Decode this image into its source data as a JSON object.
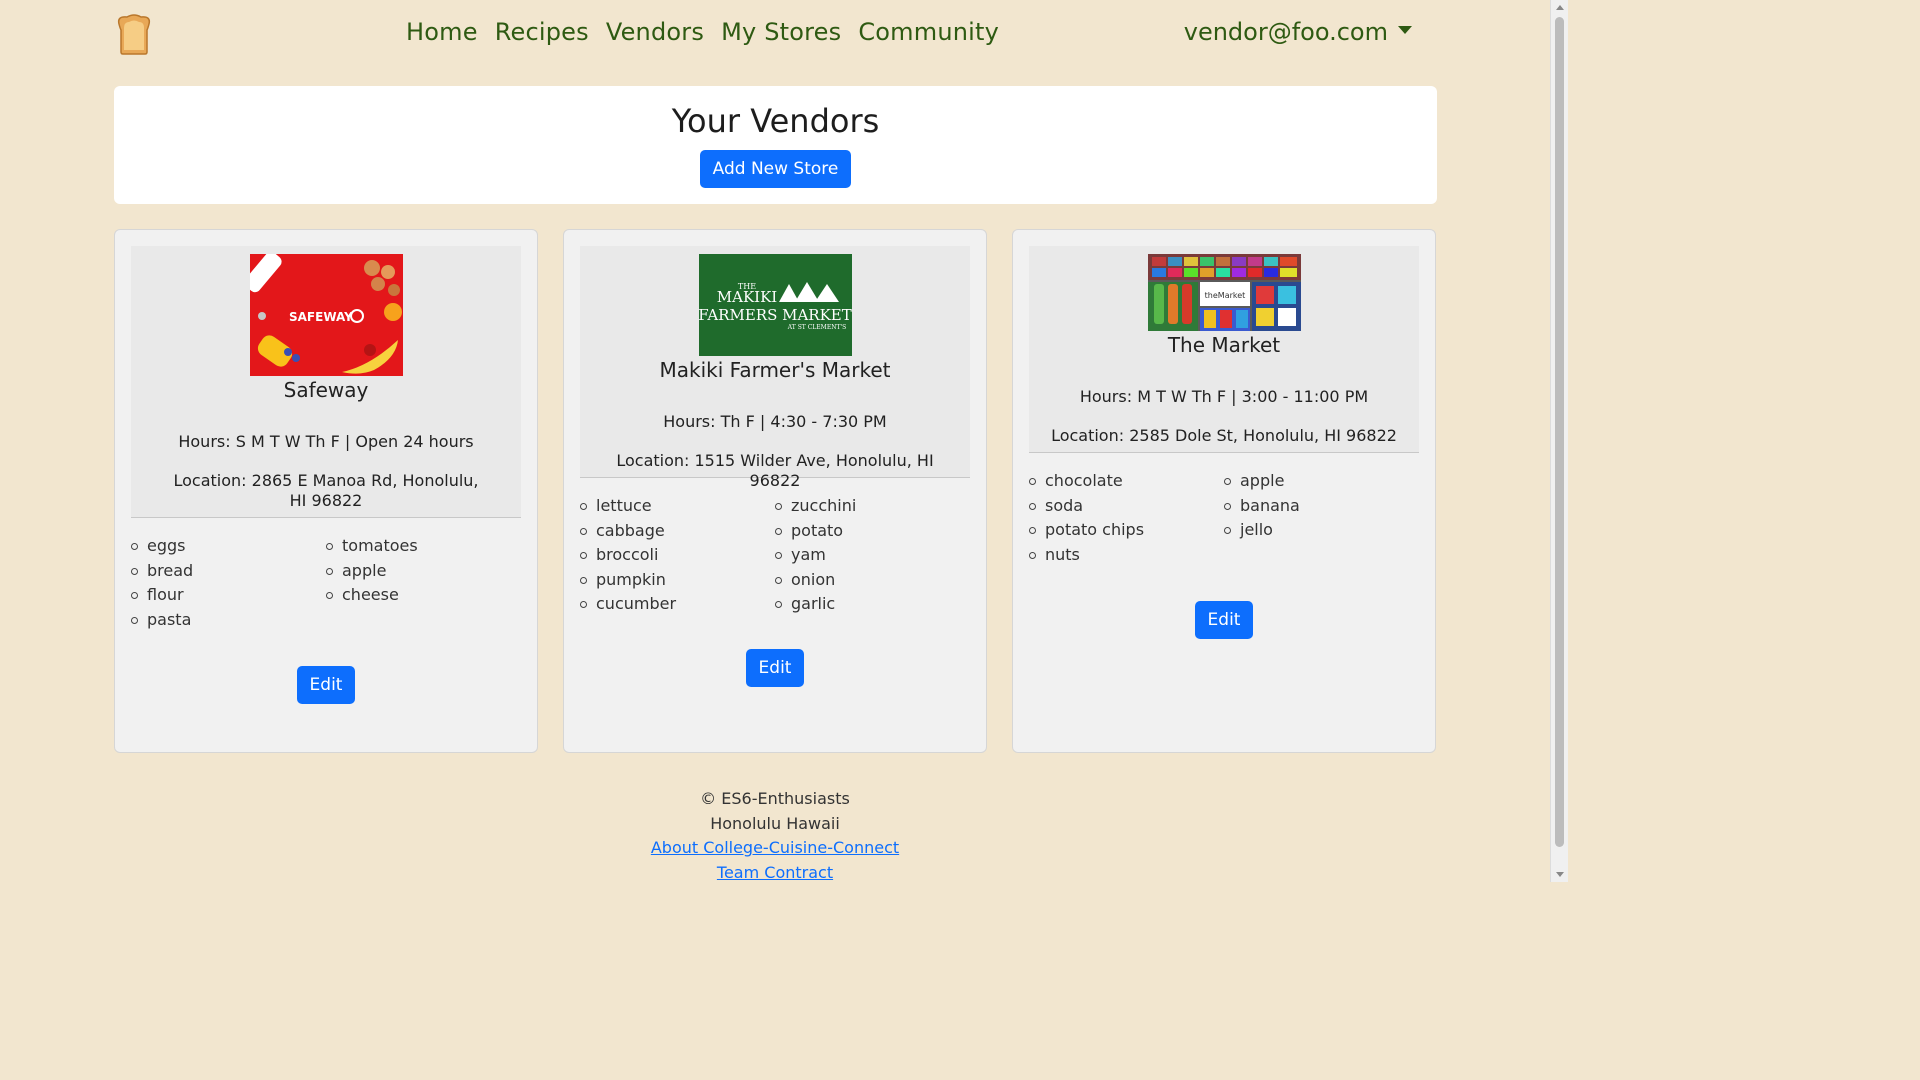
{
  "nav": {
    "links": [
      "Home",
      "Recipes",
      "Vendors",
      "My Stores",
      "Community"
    ],
    "user": "vendor@foo.com"
  },
  "header": {
    "title": "Your Vendors",
    "add_button": "Add New Store"
  },
  "stores": [
    {
      "name": "Safeway",
      "logo_text": "SAFEWAY",
      "hours": "Hours: S M T W Th F | Open 24 hours",
      "location": "Location: 2865 E Manoa Rd, Honolulu, HI 96822",
      "items_left": [
        "eggs",
        "bread",
        "flour",
        "pasta"
      ],
      "items_right": [
        "tomatoes",
        "apple",
        "cheese"
      ],
      "edit_label": "Edit"
    },
    {
      "name": "Makiki Farmer's Market",
      "logo_text_top": "THE",
      "logo_text_line1": "MAKIKI",
      "logo_text_line2": "FARMERS MARKET",
      "logo_text_sub": "AT ST CLEMENT'S",
      "hours": "Hours: Th F | 4:30 - 7:30 PM",
      "location": "Location: 1515 Wilder Ave, Honolulu, HI 96822",
      "items_left": [
        "lettuce",
        "cabbage",
        "broccoli",
        "pumpkin",
        "cucumber"
      ],
      "items_right": [
        "zucchini",
        "potato",
        "yam",
        "onion",
        "garlic"
      ],
      "edit_label": "Edit"
    },
    {
      "name": "The Market",
      "logo_text": "theMarket",
      "hours": "Hours: M T W Th F | 3:00 - 11:00 PM",
      "location": "Location: 2585 Dole St, Honolulu, HI 96822",
      "items_left": [
        "chocolate",
        "soda",
        "potato chips",
        "nuts"
      ],
      "items_right": [
        "apple",
        "banana",
        "jello"
      ],
      "edit_label": "Edit"
    }
  ],
  "footer": {
    "copyright": "© ES6-Enthusiasts",
    "place": "Honolulu Hawaii",
    "about_link": "About College-Cuisine-Connect",
    "contract_link": "Team Contract"
  },
  "colors": {
    "background": "#f2e6cf",
    "nav_text": "#2e5a12",
    "primary": "#0d6efd"
  }
}
